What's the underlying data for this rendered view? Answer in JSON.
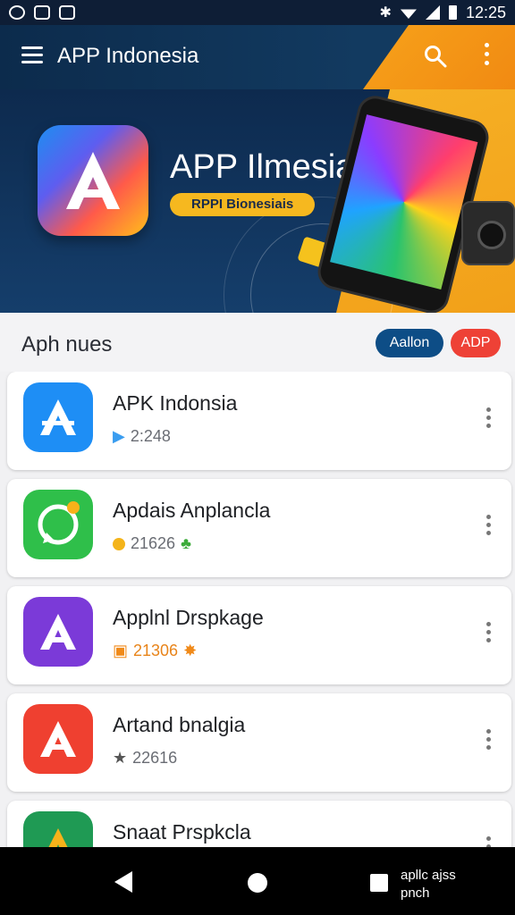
{
  "status_bar": {
    "time": "12:25"
  },
  "app_bar": {
    "title": "APP Indonesia"
  },
  "banner": {
    "title": "APP Ilmesia",
    "subtitle": "RPPI Bionesiais"
  },
  "section": {
    "title": "Aph nues",
    "chip_blue": "Aallon",
    "chip_red": "ADP"
  },
  "apps": [
    {
      "name": "APK Indonsia",
      "meta": "2:248",
      "icon_color": "#1e8ef5"
    },
    {
      "name": "Apdais Anplancla",
      "meta": "21626",
      "icon_color": "#2fbf4a"
    },
    {
      "name": "Applnl Drspkage",
      "meta": "21306",
      "icon_color": "#7b3ad8"
    },
    {
      "name": "Artand bnalgia",
      "meta": "22616",
      "icon_color": "#ef4030"
    },
    {
      "name": "Snaat Prspkcla",
      "meta": "",
      "icon_color": "#1f9a54"
    }
  ],
  "nav_bar": {
    "text_line1": "apllc ajss",
    "text_line2": "pnch"
  }
}
